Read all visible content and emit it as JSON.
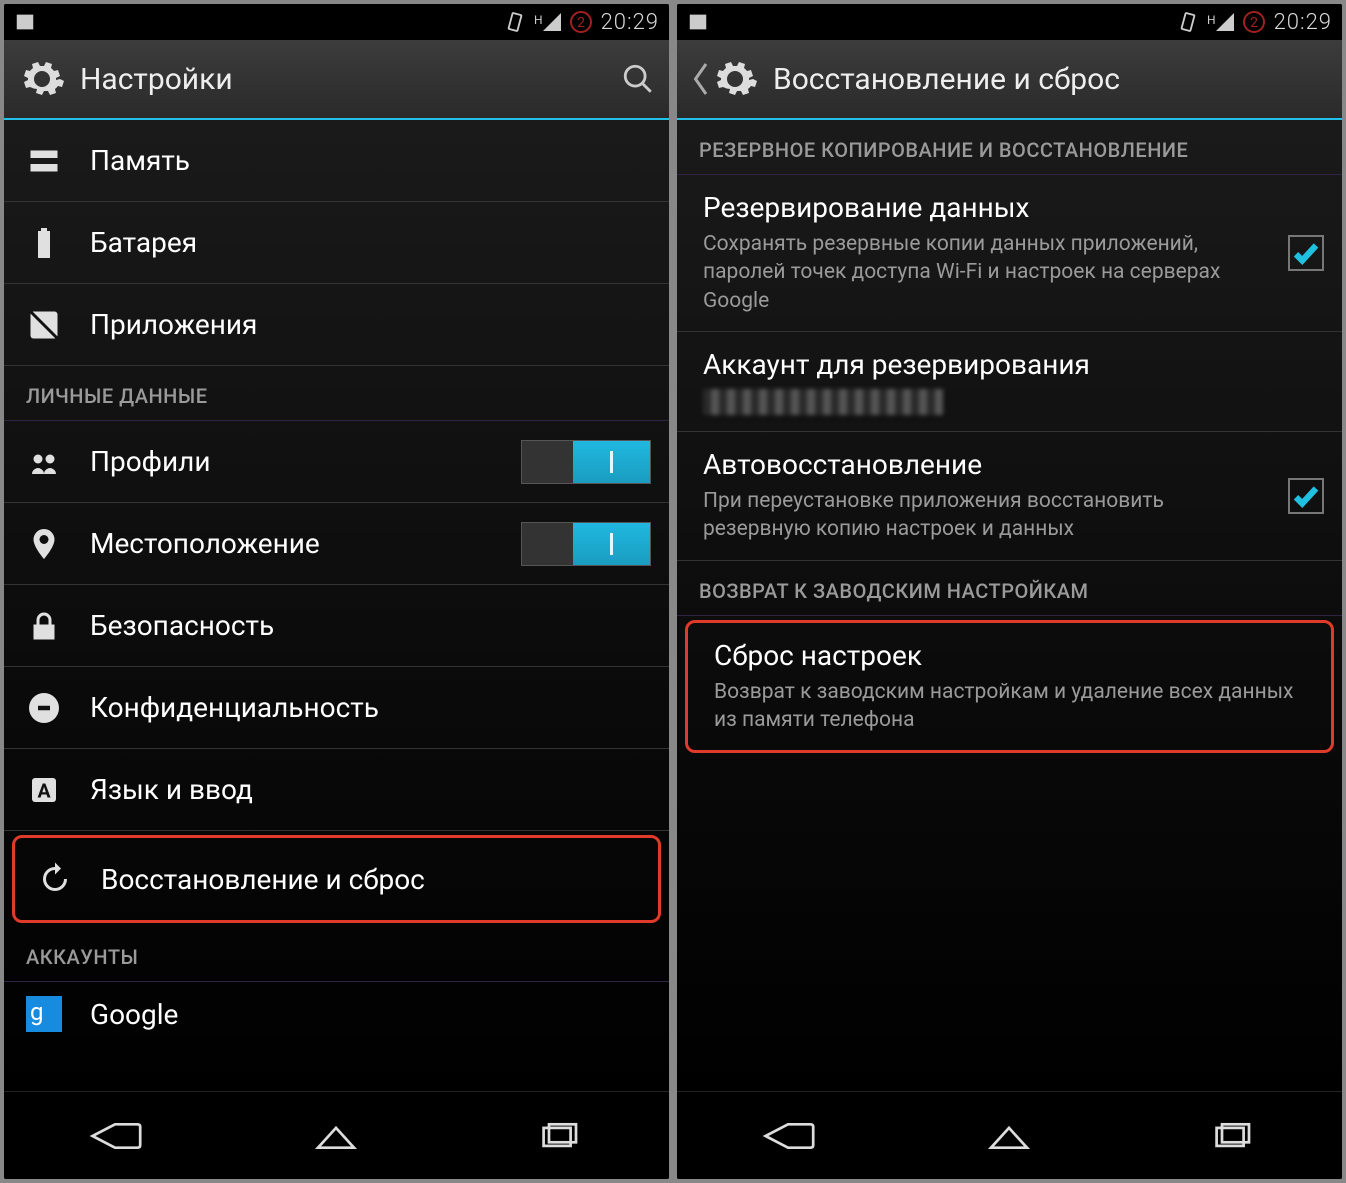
{
  "status": {
    "clock": "20:29",
    "data_badge": "H",
    "sim_badge": "2"
  },
  "left": {
    "actionbar_title": "Настройки",
    "items": {
      "memory": "Память",
      "battery": "Батарея",
      "apps": "Приложения"
    },
    "section_personal": "ЛИЧНЫЕ ДАННЫЕ",
    "profiles": "Профили",
    "location": "Местоположение",
    "security": "Безопасность",
    "privacy": "Конфиденциальность",
    "language": "Язык и ввод",
    "backup_reset": "Восстановление и сброс",
    "section_accounts": "АККАУНТЫ",
    "google": "Google"
  },
  "right": {
    "actionbar_title": "Восстановление и сброс",
    "section_backup": "РЕЗЕРВНОЕ КОПИРОВАНИЕ И ВОССТАНОВЛЕНИЕ",
    "backup_data_title": "Резервирование данных",
    "backup_data_desc": "Сохранять резервные копии данных приложений, паролей точек доступа Wi-Fi и настроек на серверах Google",
    "backup_account_title": "Аккаунт для резервирования",
    "auto_restore_title": "Автовосстановление",
    "auto_restore_desc": "При переустановке приложения восстановить резервную копию настроек и данных",
    "section_reset": "ВОЗВРАТ К ЗАВОДСКИМ НАСТРОЙКАМ",
    "reset_title": "Сброс настроек",
    "reset_desc": "Возврат к заводским настройкам и удаление всех данных из памяти телефона"
  }
}
